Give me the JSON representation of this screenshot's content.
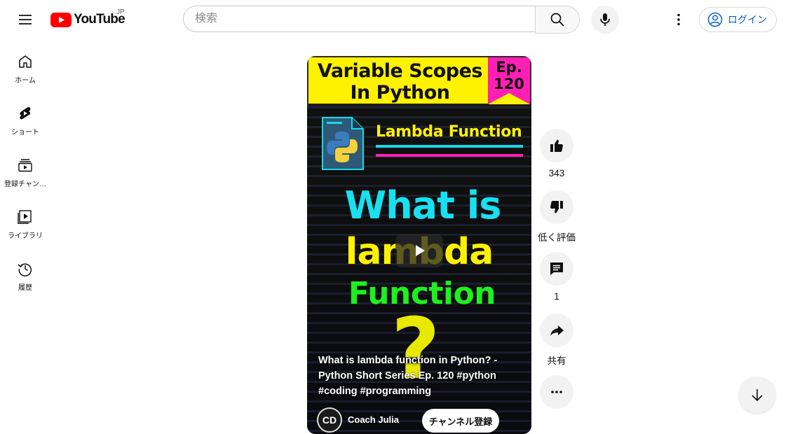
{
  "header": {
    "logo_text": "YouTube",
    "region": "JP",
    "search_placeholder": "検索",
    "login_label": "ログイン"
  },
  "sidebar": {
    "items": [
      {
        "label": "ホーム",
        "icon": "home-icon"
      },
      {
        "label": "ショート",
        "icon": "shorts-icon"
      },
      {
        "label": "登録チャン…",
        "icon": "subscriptions-icon"
      },
      {
        "label": "ライブラリ",
        "icon": "library-icon"
      },
      {
        "label": "履歴",
        "icon": "history-icon"
      }
    ]
  },
  "video": {
    "banner_title": "Variable Scopes In Python",
    "episode_badge": "Ep. 120",
    "thumb_heading": "Lambda Function",
    "big_line1": "What is",
    "big_line2": "lambda",
    "big_line3": "Function",
    "question_mark": "?",
    "caption": "What is lambda function in Python? - Python Short Series Ep. 120 #python #coding #programming",
    "channel_avatar": "CD",
    "channel_name": "Coach Julia",
    "subscribe_label": "チャンネル登録"
  },
  "actions": {
    "like_count": "343",
    "dislike_label": "低く評価",
    "comment_count": "1",
    "share_label": "共有"
  },
  "colors": {
    "brand_red": "#ff0000",
    "link_blue": "#065fd4",
    "banner_yellow": "#fff200",
    "badge_pink": "#ff1fb4",
    "cyan": "#19e0f0",
    "green": "#1df01d"
  }
}
